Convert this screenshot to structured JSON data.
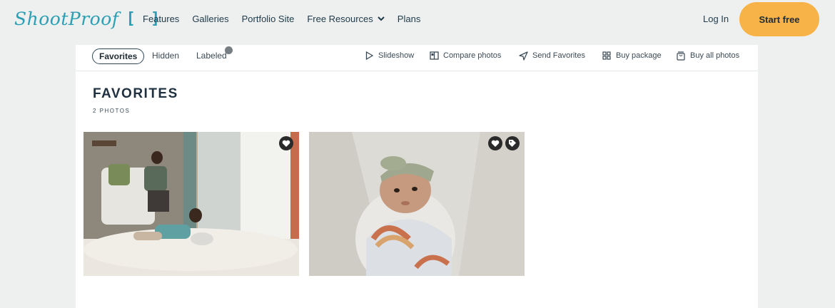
{
  "brand": {
    "logo_text": "ShootProof",
    "logo_brackets": "[ ]"
  },
  "nav": {
    "links": [
      "Features",
      "Galleries",
      "Portfolio Site",
      "Free Resources",
      "Plans"
    ],
    "login": "Log In",
    "cta": "Start free"
  },
  "tabs": {
    "favorites": "Favorites",
    "hidden": "Hidden",
    "labeled": "Labeled"
  },
  "actions": {
    "slideshow": "Slideshow",
    "compare": "Compare photos",
    "send": "Send Favorites",
    "package": "Buy package",
    "buy_all": "Buy all photos"
  },
  "section": {
    "title": "FAVORITES",
    "count": "2 PHOTOS"
  },
  "colors": {
    "brand": "#2c9fb3",
    "cta": "#f7b347",
    "badge": "#2a2a2a"
  },
  "photos": [
    {
      "subject": "father and child in nursery",
      "badges": [
        "heart-icon"
      ]
    },
    {
      "subject": "swaddled newborn with headband",
      "badges": [
        "heart-icon",
        "tag-icon"
      ]
    }
  ]
}
